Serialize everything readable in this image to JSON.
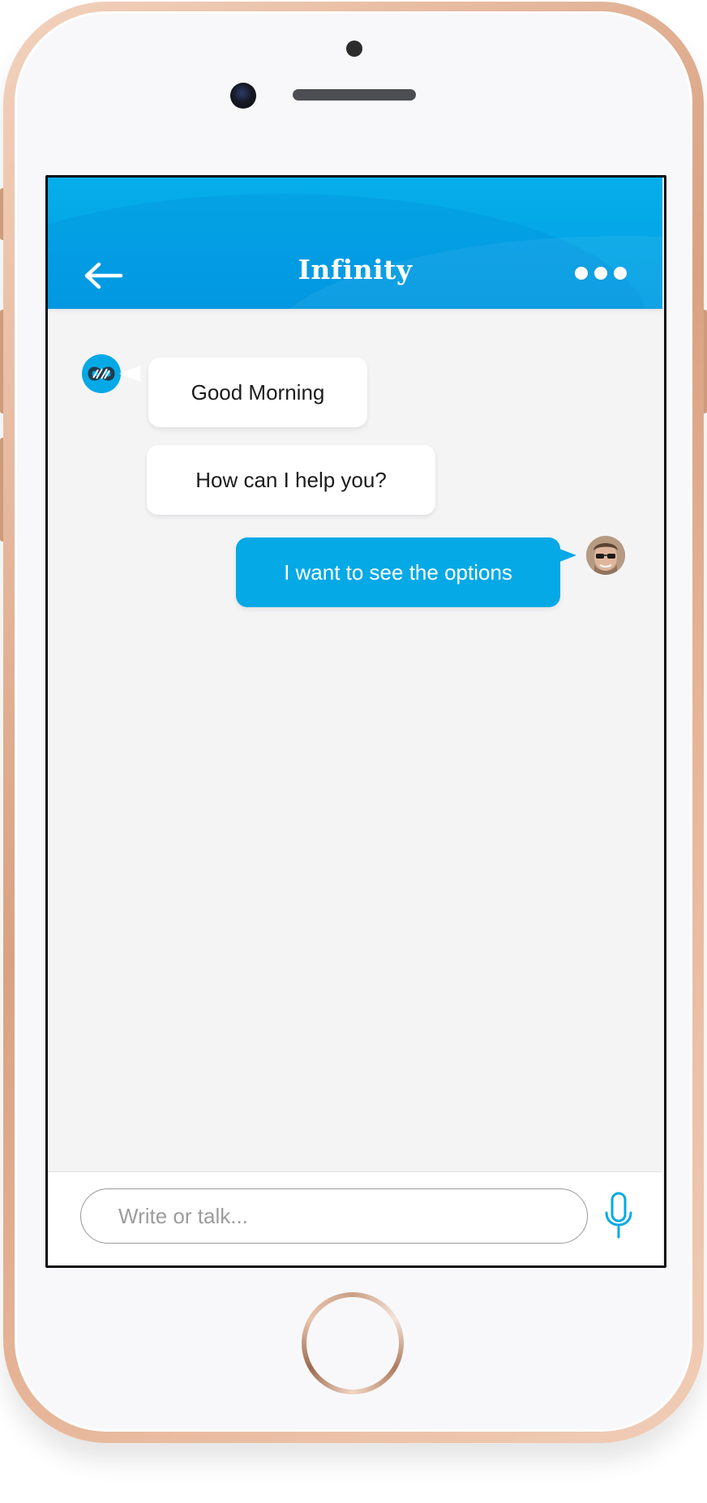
{
  "app": {
    "title": "Infinity",
    "accent_color": "#05a9e6",
    "header_color": "#039ee4"
  },
  "header": {
    "back_icon": "arrow-left-icon",
    "more_icon": "more-dots-icon"
  },
  "messages": [
    {
      "sender": "bot",
      "text": "Good Morning"
    },
    {
      "sender": "bot",
      "text": "How can I help you?"
    },
    {
      "sender": "user",
      "text": "I want to see the options"
    }
  ],
  "composer": {
    "placeholder": "Write or talk...",
    "value": "",
    "mic_icon": "microphone-icon"
  }
}
